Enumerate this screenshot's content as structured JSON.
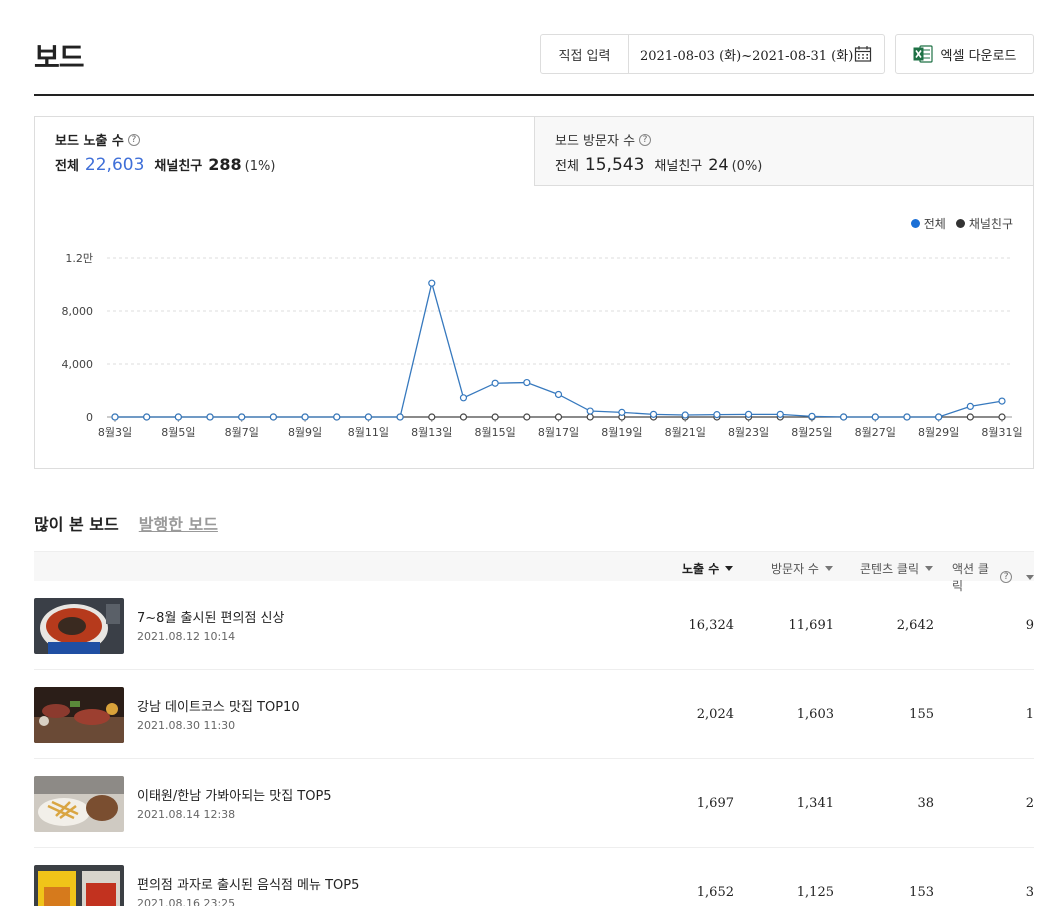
{
  "page": {
    "title": "보드"
  },
  "date_filter": {
    "mode_label": "직접 입력",
    "range": "2021-08-03 (화)~2021-08-31 (화)"
  },
  "excel": {
    "label": "엑셀 다운로드"
  },
  "tabs": [
    {
      "title": "보드 노출 수",
      "total_label": "전체",
      "total": "22,603",
      "friend_label": "채널친구",
      "friend": "288",
      "friend_pct": "(1%)"
    },
    {
      "title": "보드 방문자 수",
      "total_label": "전체",
      "total": "15,543",
      "friend_label": "채널친구",
      "friend": "24",
      "friend_pct": "(0%)"
    }
  ],
  "colors": {
    "series_total": "#3779be",
    "series_friend": "#444444",
    "accent_number": "#3f6fd8"
  },
  "chart_data": {
    "type": "line",
    "legend_placement": "top-right",
    "grid": true,
    "ylim": [
      0,
      12000
    ],
    "y_ticks": [
      0,
      4000,
      8000,
      12000
    ],
    "y_tick_labels": [
      "0",
      "4,000",
      "8,000",
      "1.2만"
    ],
    "x": [
      "8월3일",
      "8월4일",
      "8월5일",
      "8월6일",
      "8월7일",
      "8월8일",
      "8월9일",
      "8월10일",
      "8월11일",
      "8월12일",
      "8월13일",
      "8월14일",
      "8월15일",
      "8월16일",
      "8월17일",
      "8월18일",
      "8월19일",
      "8월20일",
      "8월21일",
      "8월22일",
      "8월23일",
      "8월24일",
      "8월25일",
      "8월26일",
      "8월27일",
      "8월28일",
      "8월29일",
      "8월30일",
      "8월31일"
    ],
    "x_tick_labels": [
      "8월3일",
      "8월5일",
      "8월7일",
      "8월9일",
      "8월11일",
      "8월13일",
      "8월15일",
      "8월17일",
      "8월19일",
      "8월21일",
      "8월23일",
      "8월25일",
      "8월27일",
      "8월29일",
      "8월31일"
    ],
    "series": [
      {
        "name": "전체",
        "values": [
          0,
          0,
          0,
          0,
          0,
          0,
          0,
          0,
          0,
          0,
          10100,
          1450,
          2550,
          2600,
          1700,
          450,
          350,
          200,
          150,
          180,
          200,
          200,
          50,
          0,
          0,
          0,
          0,
          800,
          1200
        ]
      },
      {
        "name": "채널친구",
        "values": [
          0,
          0,
          0,
          0,
          0,
          0,
          0,
          0,
          0,
          0,
          0,
          0,
          0,
          0,
          0,
          0,
          0,
          0,
          0,
          0,
          0,
          0,
          0,
          0,
          0,
          0,
          0,
          0,
          0
        ]
      }
    ]
  },
  "sections": {
    "active": "많이 본 보드",
    "inactive": "발행한 보드"
  },
  "table": {
    "columns": [
      "노출 수",
      "방문자 수",
      "콘텐츠 클릭",
      "액션 클릭"
    ],
    "rows": [
      {
        "title": "7~8월 출시된 편의점 신상",
        "date": "2021.08.12 10:14",
        "views": "16,324",
        "visitors": "11,691",
        "content_clicks": "2,642",
        "action_clicks": "9"
      },
      {
        "title": "강남 데이트코스 맛집 TOP10",
        "date": "2021.08.30 11:30",
        "views": "2,024",
        "visitors": "1,603",
        "content_clicks": "155",
        "action_clicks": "1"
      },
      {
        "title": "이태원/한남 가봐아되는 맛집 TOP5",
        "date": "2021.08.14 12:38",
        "views": "1,697",
        "visitors": "1,341",
        "content_clicks": "38",
        "action_clicks": "2"
      },
      {
        "title": "편의점 과자로 출시된 음식점 메뉴 TOP5",
        "date": "2021.08.16 23:25",
        "views": "1,652",
        "visitors": "1,125",
        "content_clicks": "153",
        "action_clicks": "3"
      }
    ]
  }
}
